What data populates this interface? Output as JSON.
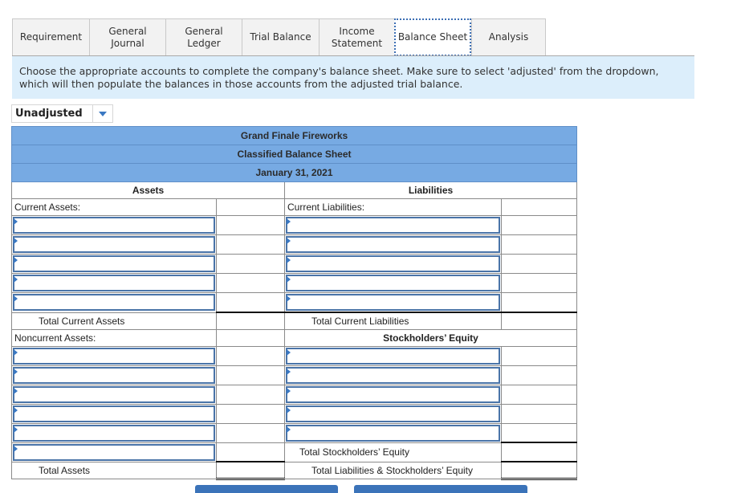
{
  "tabs": [
    {
      "label": "Requirement",
      "active": false
    },
    {
      "label": "General Journal",
      "active": false
    },
    {
      "label": "General Ledger",
      "active": false
    },
    {
      "label": "Trial Balance",
      "active": false
    },
    {
      "label": "Income Statement",
      "active": false
    },
    {
      "label": "Balance Sheet",
      "active": true
    },
    {
      "label": "Analysis",
      "active": false
    }
  ],
  "instructions": "Choose the appropriate accounts to complete the company's balance sheet. Make sure to select 'adjusted' from the dropdown, which will then populate the balances in those accounts from the adjusted trial balance.",
  "dropdown": {
    "selected": "Unadjusted",
    "icon": "triangle-down-icon"
  },
  "sheet": {
    "company": "Grand Finale Fireworks",
    "title": "Classified Balance Sheet",
    "date": "January 31, 2021",
    "assets_header": "Assets",
    "liabilities_header": "Liabilities",
    "current_assets_label": "Current Assets:",
    "current_liabilities_label": "Current Liabilities:",
    "total_current_assets": "Total Current Assets",
    "total_current_liabilities": "Total Current Liabilities",
    "noncurrent_assets_label": "Noncurrent Assets:",
    "stockholders_equity_header": "Stockholders’ Equity",
    "total_stockholders_equity": "Total Stockholders’ Equity",
    "total_assets": "Total Assets",
    "total_liabilities_equity": "Total Liabilities & Stockholders’ Equity"
  },
  "colors": {
    "accent": "#3b73b9",
    "header_fill": "#77aae3",
    "instructions_bg": "#dceefb"
  }
}
